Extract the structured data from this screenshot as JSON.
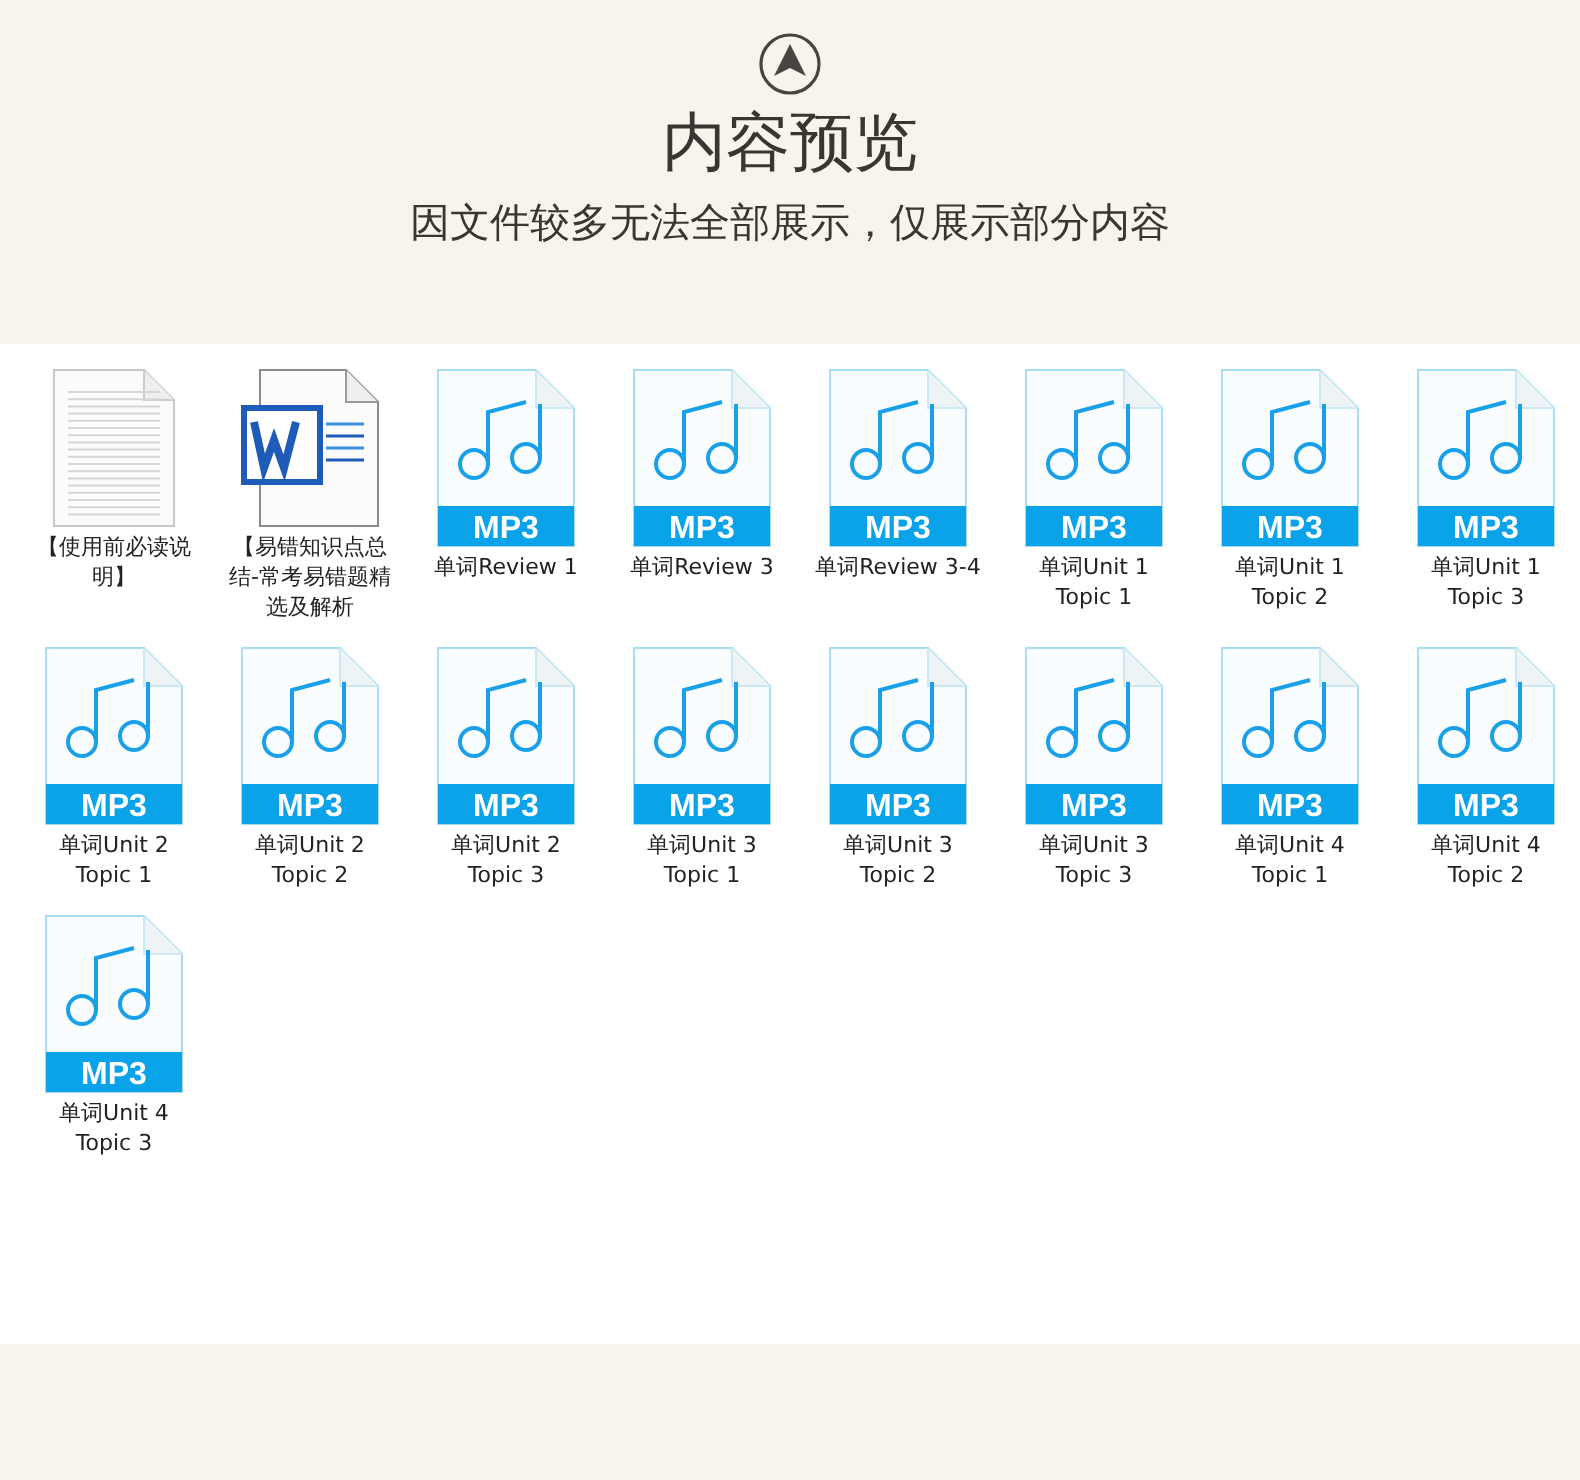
{
  "header": {
    "title": "内容预览",
    "subtitle": "因文件较多无法全部展示，仅展示部分内容"
  },
  "files": [
    {
      "kind": "text",
      "lines": [
        "【使用前必读说",
        "明】"
      ]
    },
    {
      "kind": "word",
      "lines": [
        "【易错知识点总",
        "结-常考易错题精",
        "选及解析"
      ]
    },
    {
      "kind": "mp3",
      "badge": "MP3",
      "lines": [
        "单词Review 1"
      ]
    },
    {
      "kind": "mp3",
      "badge": "MP3",
      "lines": [
        "单词Review 3"
      ]
    },
    {
      "kind": "mp3",
      "badge": "MP3",
      "lines": [
        "单词Review 3-4"
      ]
    },
    {
      "kind": "mp3",
      "badge": "MP3",
      "lines": [
        "单词Unit 1",
        "Topic 1"
      ]
    },
    {
      "kind": "mp3",
      "badge": "MP3",
      "lines": [
        "单词Unit 1",
        "Topic 2"
      ]
    },
    {
      "kind": "mp3",
      "badge": "MP3",
      "lines": [
        "单词Unit 1",
        "Topic 3"
      ]
    },
    {
      "kind": "mp3",
      "badge": "MP3",
      "lines": [
        "单词Unit 2",
        "Topic 1"
      ]
    },
    {
      "kind": "mp3",
      "badge": "MP3",
      "lines": [
        "单词Unit 2",
        "Topic 2"
      ]
    },
    {
      "kind": "mp3",
      "badge": "MP3",
      "lines": [
        "单词Unit 2",
        "Topic 3"
      ]
    },
    {
      "kind": "mp3",
      "badge": "MP3",
      "lines": [
        "单词Unit 3",
        "Topic 1"
      ]
    },
    {
      "kind": "mp3",
      "badge": "MP3",
      "lines": [
        "单词Unit 3",
        "Topic 2"
      ]
    },
    {
      "kind": "mp3",
      "badge": "MP3",
      "lines": [
        "单词Unit 3",
        "Topic 3"
      ]
    },
    {
      "kind": "mp3",
      "badge": "MP3",
      "lines": [
        "单词Unit 4",
        "Topic 1"
      ]
    },
    {
      "kind": "mp3",
      "badge": "MP3",
      "lines": [
        "单词Unit 4",
        "Topic 2"
      ]
    },
    {
      "kind": "mp3",
      "badge": "MP3",
      "lines": [
        "单词Unit 4",
        "Topic 3"
      ]
    }
  ]
}
